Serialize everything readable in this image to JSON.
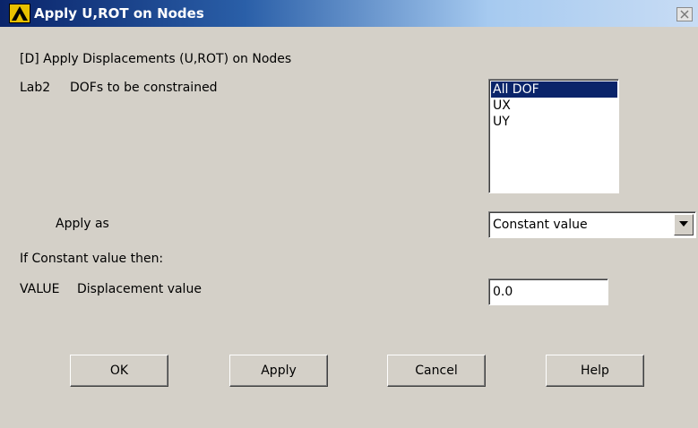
{
  "window": {
    "title": "Apply U,ROT on Nodes",
    "icon": "ansys-logo-icon",
    "close_icon": "close-icon"
  },
  "form": {
    "heading": "[D]  Apply Displacements (U,ROT) on Nodes",
    "lab2": {
      "code": "Lab2",
      "label": "DOFs to be constrained"
    },
    "dof_list": {
      "items": [
        "All DOF",
        "UX",
        "UY"
      ],
      "selected": "All DOF"
    },
    "apply_as": {
      "label": "Apply as",
      "value": "Constant value"
    },
    "if_constant_label": "If Constant value then:",
    "value_field": {
      "code": "VALUE",
      "label": "Displacement value",
      "value": "0.0"
    }
  },
  "buttons": {
    "ok": "OK",
    "apply": "Apply",
    "cancel": "Cancel",
    "help": "Help"
  },
  "colors": {
    "dialog_bg": "#d4d0c8",
    "titlebar_start": "#0a246a",
    "selection": "#0a246a"
  }
}
